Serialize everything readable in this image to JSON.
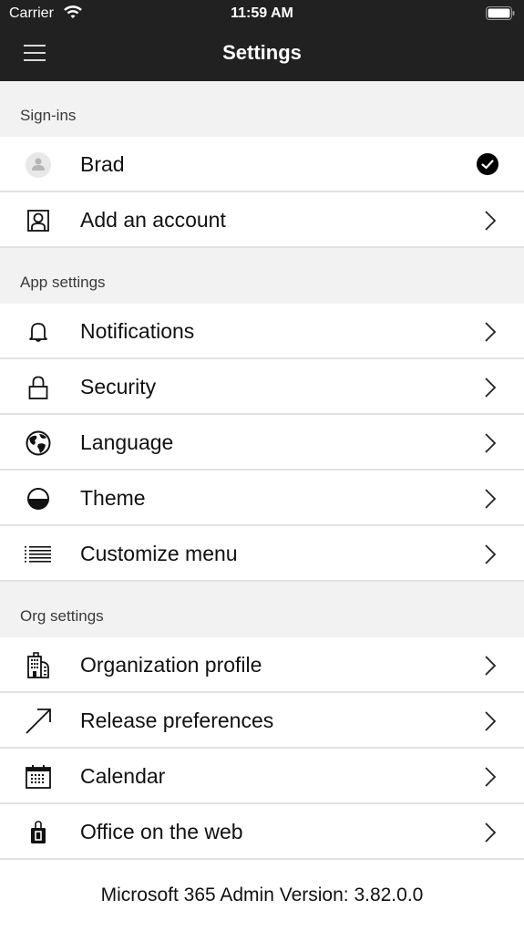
{
  "status_bar": {
    "carrier": "Carrier",
    "time": "11:59 AM"
  },
  "nav": {
    "title": "Settings",
    "menu_icon": "hamburger-icon"
  },
  "sections": [
    {
      "header": "Sign-ins",
      "items": [
        {
          "label": "Brad",
          "icon": "avatar-icon",
          "accessory": "checkmark-icon"
        },
        {
          "label": "Add an account",
          "icon": "add-account-icon",
          "accessory": "chevron-right-icon"
        }
      ]
    },
    {
      "header": "App settings",
      "items": [
        {
          "label": "Notifications",
          "icon": "bell-icon",
          "accessory": "chevron-right-icon"
        },
        {
          "label": "Security",
          "icon": "lock-icon",
          "accessory": "chevron-right-icon"
        },
        {
          "label": "Language",
          "icon": "globe-icon",
          "accessory": "chevron-right-icon"
        },
        {
          "label": "Theme",
          "icon": "half-circle-icon",
          "accessory": "chevron-right-icon"
        },
        {
          "label": "Customize menu",
          "icon": "list-icon",
          "accessory": "chevron-right-icon"
        }
      ]
    },
    {
      "header": "Org settings",
      "items": [
        {
          "label": "Organization profile",
          "icon": "building-icon",
          "accessory": "chevron-right-icon"
        },
        {
          "label": "Release preferences",
          "icon": "arrow-up-right-icon",
          "accessory": "chevron-right-icon"
        },
        {
          "label": "Calendar",
          "icon": "calendar-icon",
          "accessory": "chevron-right-icon"
        },
        {
          "label": "Office on the web",
          "icon": "office-bag-icon",
          "accessory": "chevron-right-icon"
        }
      ]
    }
  ],
  "footer": {
    "version_text": "Microsoft 365 Admin Version: 3.82.0.0"
  }
}
